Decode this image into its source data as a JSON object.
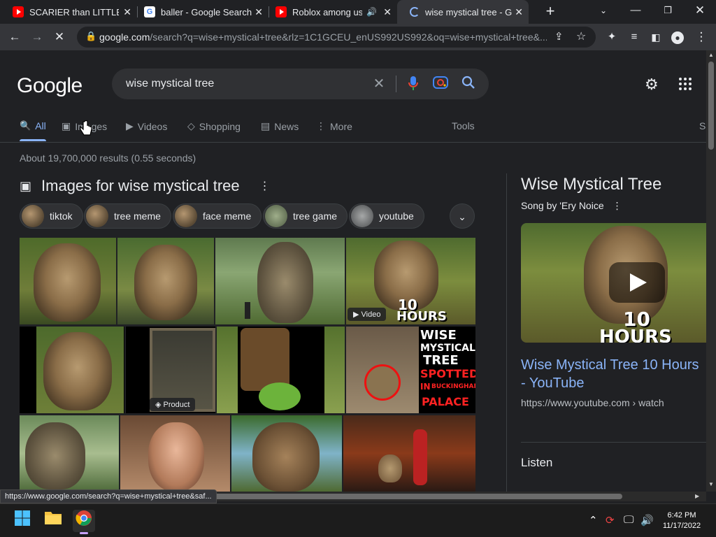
{
  "tabs": [
    {
      "label": "SCARIER than LITTLE N",
      "favicon": "youtube-icon"
    },
    {
      "label": "baller - Google Search",
      "favicon": "google-icon"
    },
    {
      "label": "Roblox among us",
      "favicon": "youtube-icon"
    },
    {
      "label": "wise mystical tree - Go",
      "favicon": "loading-icon"
    }
  ],
  "toolbar": {
    "url_main": "google.com",
    "url_rest": "/search?q=wise+mystical+tree&rlz=1C1GCEU_enUS992US992&oq=wise+mystical+tree&..."
  },
  "search": {
    "logo": "Google",
    "query": "wise mystical tree"
  },
  "nav": {
    "all": "All",
    "images": "Images",
    "videos": "Videos",
    "shopping": "Shopping",
    "news": "News",
    "more": "More",
    "tools": "Tools",
    "overflow": "S"
  },
  "stats": "About 19,700,000 results (0.55 seconds)",
  "images_heading": "Images for wise mystical tree",
  "chips": [
    "tiktok",
    "tree meme",
    "face meme",
    "tree game",
    "youtube"
  ],
  "tile_labels": {
    "video_badge": "Video",
    "product_badge": "Product",
    "ten_hours_a": "10",
    "ten_hours_b": "HOURS",
    "wise": "WISE",
    "mystical": "MYSTICAL",
    "tree": "TREE",
    "spotted": "SPOTTED",
    "in": "IN",
    "buckingham": "BUCKINGHAM",
    "palace": "PALACE"
  },
  "knowledge_panel": {
    "title": "Wise Mystical Tree",
    "subtitle": "Song by 'Ery Noice",
    "video_text_a": "10",
    "video_text_b": "HOURS",
    "link": "Wise Mystical Tree 10 Hours - YouTube",
    "url": "https://www.youtube.com › watch",
    "listen": "Listen"
  },
  "status_url": "https://www.google.com/search?q=wise+mystical+tree&saf...",
  "clock": {
    "time": "6:42 PM",
    "date": "11/17/2022"
  },
  "colors": {
    "link": "#8ab4f8",
    "bg": "#202124",
    "youtube_red": "#ff0000"
  }
}
